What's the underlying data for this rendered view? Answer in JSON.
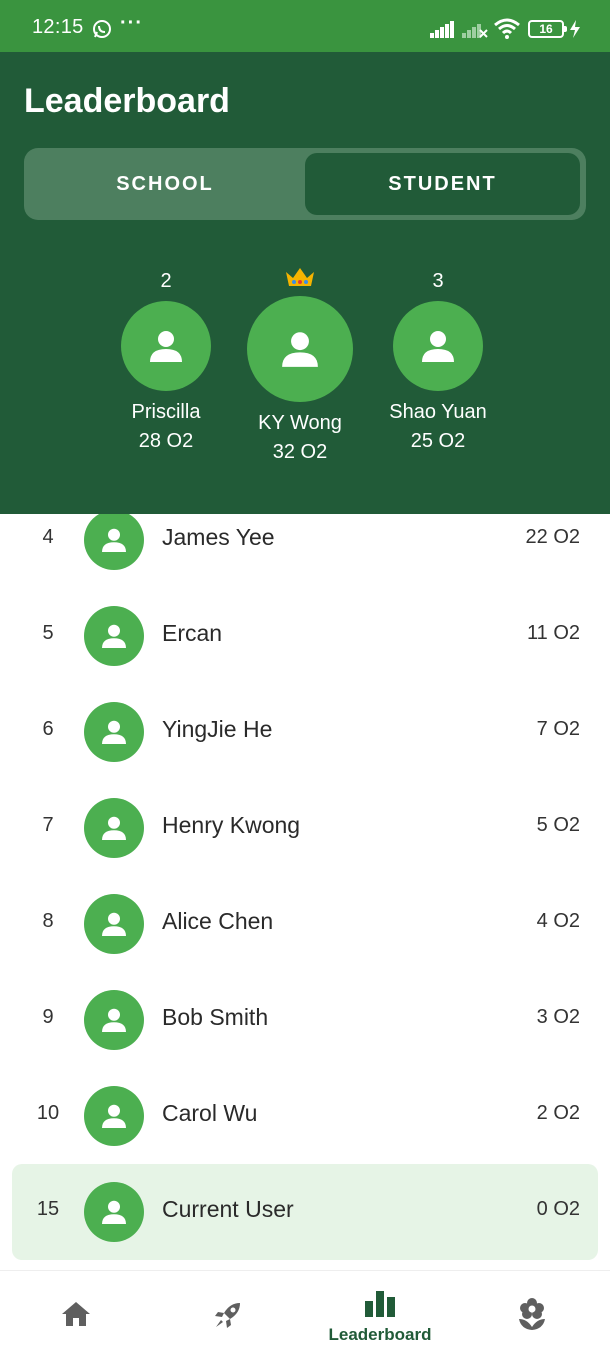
{
  "status_bar": {
    "time": "12:15",
    "dots": "···",
    "battery": "16"
  },
  "title": "Leaderboard",
  "tabs": {
    "school": "SCHOOL",
    "student": "STUDENT",
    "active": "student"
  },
  "podium": {
    "second": {
      "rank": "2",
      "name": "Priscilla",
      "score": "28 O2"
    },
    "first": {
      "name": "KY Wong",
      "score": "32 O2"
    },
    "third": {
      "rank": "3",
      "name": "Shao Yuan",
      "score": "25 O2"
    }
  },
  "list": [
    {
      "rank": "4",
      "name": "James Yee",
      "score": "22 O2"
    },
    {
      "rank": "5",
      "name": "Ercan",
      "score": "11 O2"
    },
    {
      "rank": "6",
      "name": "YingJie He",
      "score": "7 O2"
    },
    {
      "rank": "7",
      "name": "Henry Kwong",
      "score": "5 O2"
    },
    {
      "rank": "8",
      "name": "Alice Chen",
      "score": "4 O2"
    },
    {
      "rank": "9",
      "name": "Bob Smith",
      "score": "3 O2"
    },
    {
      "rank": "10",
      "name": "Carol Wu",
      "score": "2 O2"
    }
  ],
  "current_user": {
    "rank": "15",
    "name": "Current User",
    "score": "0 O2"
  },
  "nav": {
    "active_label": "Leaderboard"
  },
  "colors": {
    "status_bar": "#3a943f",
    "header": "#215b38",
    "avatar": "#4caf50",
    "current_row": "#e6f4e6"
  }
}
